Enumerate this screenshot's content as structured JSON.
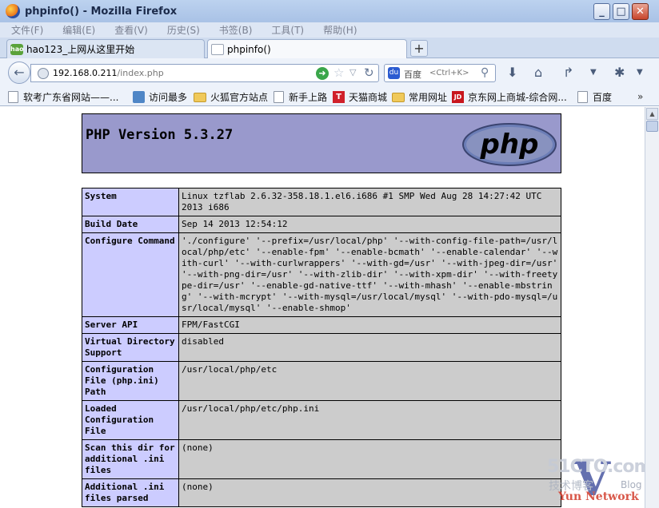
{
  "window": {
    "title": "phpinfo() - Mozilla Firefox",
    "min": "_",
    "max": "□",
    "close": "✕"
  },
  "menu": [
    "文件(F)",
    "编辑(E)",
    "查看(V)",
    "历史(S)",
    "书签(B)",
    "工具(T)",
    "帮助(H)"
  ],
  "tabs": [
    {
      "label": "hao123_上网从这里开始",
      "active": false
    },
    {
      "label": "phpinfo()",
      "active": true
    }
  ],
  "new_tab_label": "+",
  "urlbar": {
    "host": "192.168.0.211",
    "path": "/index.php"
  },
  "search": {
    "engine": "百度",
    "placeholder": "<Ctrl+K>"
  },
  "bookmarks": [
    {
      "label": "软考广东省网站——...",
      "icon": "page"
    },
    {
      "label": "访问最多",
      "icon": "most-visited"
    },
    {
      "label": "火狐官方站点",
      "icon": "folder"
    },
    {
      "label": "新手上路",
      "icon": "page"
    },
    {
      "label": "天猫商城",
      "icon": "tmall"
    },
    {
      "label": "常用网址",
      "icon": "folder"
    },
    {
      "label": "京东网上商城-综合网...",
      "icon": "jd"
    },
    {
      "label": "百度",
      "icon": "page"
    }
  ],
  "bookmarks_overflow": "»",
  "php": {
    "version_title": "PHP Version 5.3.27",
    "rows": [
      {
        "key": "System",
        "value": "Linux tzflab 2.6.32-358.18.1.el6.i686 #1 SMP Wed Aug 28 14:27:42 UTC 2013 i686"
      },
      {
        "key": "Build Date",
        "value": "Sep 14 2013 12:54:12"
      },
      {
        "key": "Configure Command",
        "value": "'./configure' '--prefix=/usr/local/php' '--with-config-file-path=/usr/local/php/etc' '--enable-fpm' '--enable-bcmath' '--enable-calendar' '--with-curl' '--with-curlwrappers' '--with-gd=/usr' '--with-jpeg-dir=/usr' '--with-png-dir=/usr' '--with-zlib-dir' '--with-xpm-dir' '--with-freetype-dir=/usr' '--enable-gd-native-ttf' '--with-mhash' '--enable-mbstring' '--with-mcrypt' '--with-mysql=/usr/local/mysql' '--with-pdo-mysql=/usr/local/mysql' '--enable-shmop'"
      },
      {
        "key": "Server API",
        "value": "FPM/FastCGI"
      },
      {
        "key": "Virtual Directory Support",
        "value": "disabled"
      },
      {
        "key": "Configuration File (php.ini) Path",
        "value": "/usr/local/php/etc"
      },
      {
        "key": "Loaded Configuration File",
        "value": "/usr/local/php/etc/php.ini"
      },
      {
        "key": "Scan this dir for additional .ini files",
        "value": "(none)"
      },
      {
        "key": "Additional .ini files parsed",
        "value": "(none)"
      }
    ]
  },
  "watermark": {
    "top": "51CTO.com",
    "sub": "技术博客",
    "blog": "Blog",
    "net": "Yun Network",
    "v": "V"
  },
  "colors": {
    "php_header": "#9999cc",
    "key_cell": "#ccccff",
    "value_cell": "#cccccc"
  }
}
